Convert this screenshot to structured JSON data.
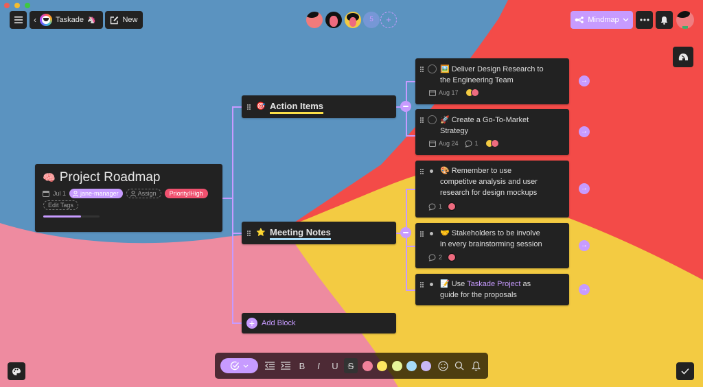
{
  "window": {
    "traffic_lights": [
      {
        "name": "close",
        "color": "#ee5f57"
      },
      {
        "name": "minimize",
        "color": "#f5bd2f"
      },
      {
        "name": "maximize",
        "color": "#3fc840"
      }
    ]
  },
  "colors": {
    "background_blue": "#5b93c0",
    "background_red": "#f34b48",
    "background_yellow": "#f3cb42",
    "background_pink": "#ee8ba0",
    "accent_purple": "#c79bff",
    "card_dark": "#222222",
    "priority_red": "#f0516f",
    "underline_yellow": "#fde047",
    "underline_blue": "#a7dbf8"
  },
  "header": {
    "menu_icon": "hamburger-icon",
    "back_icon": "chevron-left-icon",
    "workspace_name": "Taskade",
    "workspace_emoji": "🦄",
    "new_label": "New",
    "collaborators_extra_count": "5",
    "add_collaborator_icon": "plus-icon",
    "view_mode_label": "Mindmap",
    "more_icon": "ellipsis-icon",
    "bell_icon": "bell-icon"
  },
  "side_buttons": {
    "top_right_icon": "helmet-icon",
    "bottom_left_icon": "palette-icon",
    "bottom_right_icon": "check-icon"
  },
  "root": {
    "emoji": "🧠",
    "title": "Project Roadmap",
    "date": "Jul 1",
    "assignee": "jane-manager",
    "assign_label": "Assign",
    "priority_tag": "Priority/High",
    "edit_tags_label": "Edit Tags",
    "progress": 0.67
  },
  "sections": [
    {
      "emoji": "🎯",
      "title": "Action Items",
      "items": [
        {
          "type": "task",
          "emoji": "🖼️",
          "line1": "Deliver Design Research to",
          "line2": "the Engineering Team",
          "date": "Aug 17",
          "comments": null
        },
        {
          "type": "task",
          "emoji": "🚀",
          "line1": "Create a Go-To-Market",
          "line2": "Strategy",
          "date": "Aug 24",
          "comments": "1"
        }
      ]
    },
    {
      "emoji": "⭐",
      "title": "Meeting Notes",
      "items": [
        {
          "type": "bullet",
          "emoji": "🎨",
          "line1": "Remember to use",
          "line2": "competitve analysis and user",
          "line3": "research for design mockups",
          "comments": "1"
        },
        {
          "type": "bullet",
          "emoji": "🤝",
          "line1": "Stakeholders to be involve",
          "line2": "in every brainstorming session",
          "comments": "2"
        },
        {
          "type": "bullet",
          "emoji": "📝",
          "pre": "Use ",
          "link": "Taskade Project",
          "post": " as",
          "line2": "guide for the proposals"
        }
      ]
    }
  ],
  "add_block_label": "Add Block",
  "toolbar": {
    "check_icon": "check-circle-icon",
    "outdent_icon": "outdent-icon",
    "indent_icon": "indent-icon",
    "bold": "B",
    "italic": "I",
    "underline": "U",
    "strike": "S",
    "swatches": [
      "#f0819a",
      "#fde760",
      "#e6f59a",
      "#a7dbf8",
      "#c9b8f7"
    ],
    "emoji_icon": "smile-icon",
    "search_icon": "search-icon",
    "reminder_icon": "bell-icon"
  }
}
